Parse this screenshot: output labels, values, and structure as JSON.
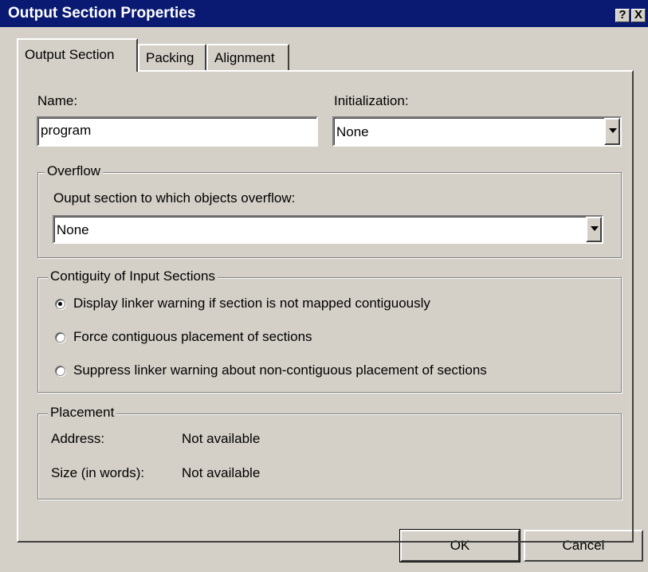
{
  "window": {
    "title": "Output Section Properties",
    "help_button": "?",
    "close_button": "X"
  },
  "tabs": [
    {
      "label": "Output Section",
      "active": true
    },
    {
      "label": "Packing",
      "active": false
    },
    {
      "label": "Alignment",
      "active": false
    }
  ],
  "name_field": {
    "label": "Name:",
    "value": "program"
  },
  "initialization": {
    "label": "Initialization:",
    "selected": "None"
  },
  "overflow": {
    "legend": "Overflow",
    "label": "Ouput section to which objects overflow:",
    "selected": "None"
  },
  "contiguity": {
    "legend": "Contiguity of Input Sections",
    "options": [
      {
        "label": "Display linker warning if section is not mapped contiguously",
        "checked": true
      },
      {
        "label": "Force contiguous placement of sections",
        "checked": false
      },
      {
        "label": "Suppress linker warning about non-contiguous placement of sections",
        "checked": false
      }
    ]
  },
  "placement": {
    "legend": "Placement",
    "address_label": "Address:",
    "address_value": "Not available",
    "size_label": "Size (in words):",
    "size_value": "Not available"
  },
  "buttons": {
    "ok": "OK",
    "cancel": "Cancel"
  },
  "colors": {
    "titlebar": "#0a1a72",
    "face": "#d4d0c8"
  }
}
